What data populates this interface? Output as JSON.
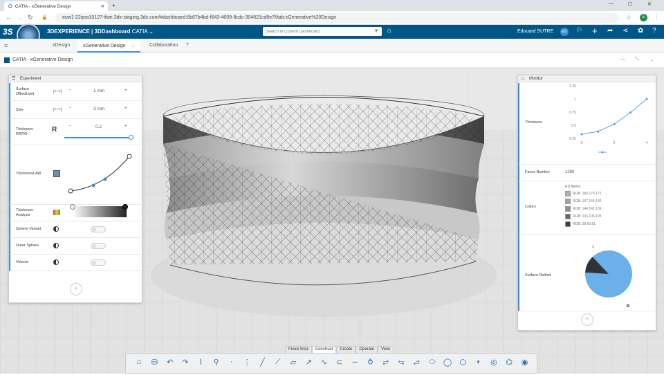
{
  "browser": {
    "tab_title": "CATIA - xGenerative Design",
    "url": "euw1-22qna10127-ifwe.3dx-staging.3ds.com/#dashboard:6b67b4bd-f643-4009-8cdc-304821cd8e7f/tab:xGenerative%20Design",
    "profile_initial": "E"
  },
  "topbar": {
    "brand_bold": "3D",
    "brand_rest": "EXPERIENCE | 3DDashboard",
    "brand_app": "CATIA",
    "search_placeholder": "Search in Current Dashboard",
    "user_name": "Edouard SUTRE",
    "user_initials": "ES"
  },
  "tabs": [
    "xDesign",
    "xGenerative Design",
    "Collaboration"
  ],
  "app_title": "CATIA - xGenerative Design",
  "experiment": {
    "title": "Experiment",
    "surface_offset": {
      "label": "Surface OffsetLimit",
      "value": "1 mm"
    },
    "size": {
      "label": "Size",
      "value": "3 mm"
    },
    "thickness_ratio": {
      "label": "Thickness RATIO",
      "value": "0.2"
    },
    "thickness_law": {
      "label": "ThicknessLAW"
    },
    "thickness_analysis": {
      "label": "Thickness Analysis"
    },
    "sphere_variant": {
      "label": "Sphere Variant"
    },
    "outer_sphere": {
      "label": "Outer Sphere"
    },
    "volume": {
      "label": "Volume"
    }
  },
  "monitor": {
    "title": "Monitor",
    "thickness_label": "Thickness",
    "faces_label": "Faces Number",
    "faces_value": "1280",
    "colors_label": "Colors",
    "colors_count": "▾ 5 items",
    "colors": [
      {
        "text": "RGB: 180,176,172",
        "hex": "#b4b0ac"
      },
      {
        "text": "RGB: 167,164,160",
        "hex": "#a7a4a0"
      },
      {
        "text": "RGB: 144,141,139",
        "hex": "#908d8b"
      },
      {
        "text": "RGB: 106,105,105",
        "hex": "#6a6969"
      },
      {
        "text": "RGB: 58,60,61",
        "hex": "#3a3c3d"
      }
    ],
    "surface_label": "Surface Relimit"
  },
  "chart_data": [
    {
      "type": "line",
      "x": [
        0,
        1,
        2,
        3,
        4
      ],
      "values": [
        0.33,
        0.38,
        0.52,
        0.74,
        1.0
      ],
      "ylim": [
        0.25,
        1.25
      ],
      "yticks": [
        "1.25",
        "1",
        "0.75",
        "0.5",
        "0.25"
      ],
      "xticks": [
        "0",
        "2",
        "4"
      ],
      "color": "#5aa0e0"
    },
    {
      "type": "pie",
      "values": [
        0.88,
        0.12
      ],
      "colors": [
        "#6cb0ea",
        "#2f3438"
      ],
      "labels": [
        "",
        "1"
      ]
    }
  ],
  "bottom_tabs": [
    "Fixed Area",
    "Construct",
    "Create",
    "Operate",
    "View"
  ],
  "toolbar_icons": [
    "home-icon",
    "database-icon",
    "undo-icon",
    "redo-icon",
    "wifi-icon",
    "tree-icon",
    "point-icon",
    "grid-icon",
    "line-icon",
    "slash-icon",
    "plane-icon",
    "arrow-icon",
    "curve-icon",
    "arc-icon",
    "spline-icon",
    "twist-icon",
    "twist2-icon",
    "twist3-icon",
    "twist4-icon",
    "cylinder-icon",
    "circle-icon",
    "hexagon-icon",
    "cone-icon",
    "torus-icon",
    "spring-icon",
    "spiral-icon"
  ],
  "toolbar_glyphs": [
    "⌂",
    "⛁",
    "↶",
    "↷",
    "⌇",
    "⚲",
    "·",
    "⋮",
    "╱",
    "⟋",
    "▱",
    "↗",
    "∿",
    "⊂",
    "∼",
    "⥁",
    "⥂",
    "⥃",
    "⥄",
    "⬭",
    "◯",
    "⬡",
    "◗",
    "◎",
    "⌬",
    "◉"
  ],
  "accent": "#005686"
}
